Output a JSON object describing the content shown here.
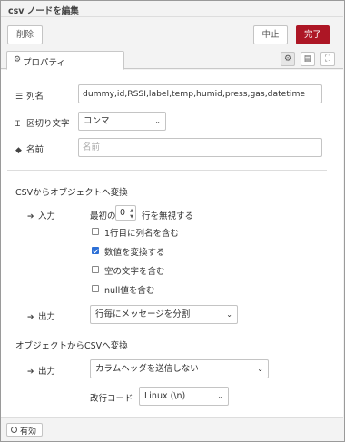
{
  "window": {
    "title": "csv ノードを編集"
  },
  "toolbar": {
    "delete_label": "削除",
    "cancel_label": "中止",
    "done_label": "完了"
  },
  "tabs": {
    "properties_label": "プロパティ"
  },
  "form": {
    "columns_label": "列名",
    "columns_value": "dummy,id,RSSI,label,temp,humid,press,gas,datetime",
    "separator_label": "区切り文字",
    "separator_value": "コンマ",
    "name_label": "名前",
    "name_placeholder": "名前"
  },
  "csv_to_obj": {
    "section_label": "CSVからオブジェクトへ変換",
    "input_label": "入力",
    "skip_prefix": "最初の",
    "skip_value": "0",
    "skip_suffix": "行を無視する",
    "options": [
      {
        "label": "1行目に列名を含む",
        "checked": false
      },
      {
        "label": "数値を変換する",
        "checked": true
      },
      {
        "label": "空の文字を含む",
        "checked": false
      },
      {
        "label": "null値を含む",
        "checked": false
      }
    ],
    "output_label": "出力",
    "output_value": "行毎にメッセージを分割"
  },
  "obj_to_csv": {
    "section_label": "オブジェクトからCSVへ変換",
    "output_label": "出力",
    "output_value": "カラムヘッダを送信しない",
    "newline_label": "改行コード",
    "newline_value": "Linux (\\n)"
  },
  "footer": {
    "enabled_label": "有効"
  }
}
